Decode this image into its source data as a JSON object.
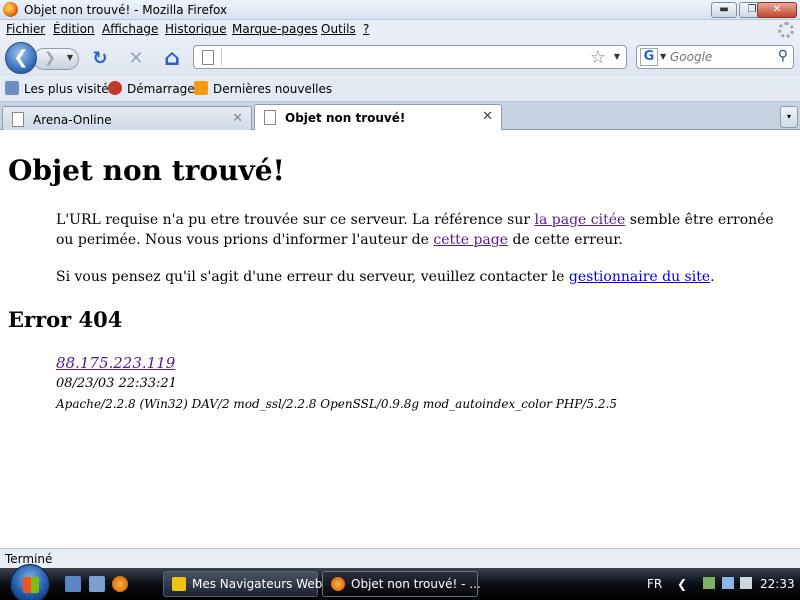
{
  "window": {
    "title": "Objet non trouvé! - Mozilla Firefox",
    "min_glyph": "▬",
    "max_glyph": "❐",
    "close_glyph": "✕"
  },
  "menu": {
    "items": [
      "Fichier",
      "Édition",
      "Affichage",
      "Historique",
      "Marque-pages",
      "Outils",
      "?"
    ]
  },
  "toolbar": {
    "back_glyph": "❮",
    "forward_glyph": "❯",
    "dropdown_glyph": "▼",
    "reload_glyph": "↻",
    "stop_glyph": "✕",
    "home_glyph": "⌂",
    "url_value": "",
    "star_glyph": "☆",
    "search_engine_glyph": "G",
    "search_placeholder": "Google",
    "search_glyph": "⚲"
  },
  "bookmarks": {
    "items": [
      "Les plus visités",
      "Démarrage",
      "Dernières nouvelles"
    ]
  },
  "tabs": {
    "items": [
      {
        "label": "Arena-Online",
        "active": false
      },
      {
        "label": "Objet non trouvé!",
        "active": true
      }
    ],
    "close_glyph": "✕",
    "list_glyph": "▾"
  },
  "page": {
    "heading": "Objet non trouvé!",
    "p1_before": "L'URL requise n'a pu etre trouvée sur ce serveur. La référence sur ",
    "p1_link1": "la page citée",
    "p1_middle": " semble être erronée ou perimée. Nous vous prions d'informer l'auteur de ",
    "p1_link2": "cette page",
    "p1_after": " de cette erreur.",
    "p2_before": "Si vous pensez qu'il s'agit d'une erreur du serveur, veuillez contacter le ",
    "p2_link": "gestionnaire du site",
    "p2_after": ".",
    "error_heading": "Error 404",
    "ip_link": "88.175.223.119",
    "datetime": "08/23/03 22:33:21",
    "server_sig": "Apache/2.2.8 (Win32) DAV/2 mod_ssl/2.2.8 OpenSSL/0.9.8g mod_autoindex_color PHP/5.2.5"
  },
  "status": {
    "text": "Terminé"
  },
  "taskbar": {
    "tasks": [
      {
        "label": "Mes Navigateurs Web",
        "active": false
      },
      {
        "label": "Objet non trouvé! - ...",
        "active": true
      }
    ],
    "language": "FR",
    "tray_arrow": "❮",
    "clock": "22:33"
  },
  "colors": {
    "link_visited": "#551a8b",
    "link_unvisited": "#0000ee",
    "vista_blue": "#1f5aa6"
  }
}
